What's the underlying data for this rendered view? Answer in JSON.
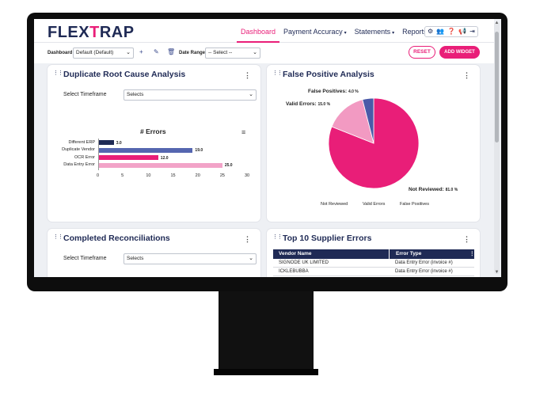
{
  "app": {
    "logo_prefix": "FLEX",
    "logo_x": "T",
    "logo_suffix": "RAP"
  },
  "nav": {
    "items": [
      {
        "label": "Dashboard",
        "active": true,
        "caret": ""
      },
      {
        "label": "Payment Accuracy",
        "active": false,
        "caret": "▾"
      },
      {
        "label": "Statements",
        "active": false,
        "caret": "▾"
      },
      {
        "label": "Reports",
        "active": false,
        "caret": ""
      }
    ],
    "icon_names": [
      "gear-icon",
      "users-icon",
      "help-icon",
      "megaphone-icon",
      "logout-icon"
    ]
  },
  "toolbar": {
    "dashboard_label": "Dashboard",
    "dashboard_value": "Default  (Default)",
    "date_range_label": "Date Range",
    "date_range_value": "-- Select --",
    "reset_label": "RESET",
    "add_widget_label": "ADD WIDGET"
  },
  "duplicate": {
    "title": "Duplicate Root Cause Analysis",
    "timeframe_label": "Select Timeframe",
    "timeframe_value": "Selects"
  },
  "false_positive": {
    "title": "False Positive Analysis"
  },
  "completed": {
    "title": "Completed Reconciliations",
    "timeframe_label": "Select Timeframe",
    "timeframe_value": "Selects"
  },
  "supplier": {
    "title": "Top 10 Supplier Errors",
    "columns": [
      "Vendor Name",
      "Error Type"
    ],
    "rows": [
      [
        "SIGNODE UK LIMITED",
        "Data Entry Error (invoice #)"
      ],
      [
        "ICKLEBUBBA",
        "Data Entry Error (invoice #)"
      ]
    ]
  },
  "chart_data": [
    {
      "type": "bar",
      "title": "# Errors",
      "categories": [
        "Different ERP",
        "Duplicate Vendor",
        "OCR Error",
        "Data Entry Error"
      ],
      "values": [
        3.0,
        19.0,
        12.0,
        25.0
      ],
      "value_labels": [
        "3.0",
        "19.0",
        "12.0",
        "25.0"
      ],
      "xlim": [
        0,
        30
      ],
      "xticks": [
        "0",
        "5",
        "10",
        "15",
        "20",
        "25",
        "30"
      ],
      "colors": [
        "#1f2a55",
        "#5566b0",
        "#e91e78",
        "#f2a3c8"
      ],
      "orientation": "horizontal",
      "grid": false
    },
    {
      "type": "pie",
      "categories": [
        "Not Reviewed",
        "Valid Errors",
        "False Positives"
      ],
      "values": [
        81.0,
        15.0,
        4.0
      ],
      "slice_labels": [
        {
          "name": "Not Reviewed:",
          "pct": "81.0 %"
        },
        {
          "name": "Valid Errors:",
          "pct": "15.0 %"
        },
        {
          "name": "False Positives:",
          "pct": "4.0 %"
        }
      ],
      "colors": [
        "#e91e78",
        "#f29ac2",
        "#4a5aa8"
      ],
      "legend": "bottom"
    }
  ]
}
